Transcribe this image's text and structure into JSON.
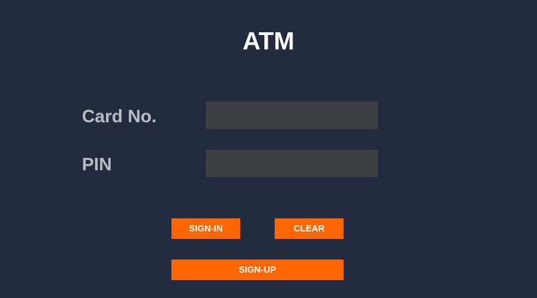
{
  "window": {
    "title": "ATM"
  },
  "form": {
    "card_label": "Card No.",
    "card_value": "",
    "card_placeholder": "",
    "pin_label": "PIN",
    "pin_value": "",
    "pin_placeholder": ""
  },
  "buttons": {
    "signin_label": "SIGN-IN",
    "clear_label": "CLEAR",
    "signup_label": "SIGN-UP"
  },
  "colors": {
    "background": "#222b40",
    "field": "#3d4043",
    "accent": "#ff6600",
    "title": "#ffffff",
    "label": "#b9bcc2"
  }
}
